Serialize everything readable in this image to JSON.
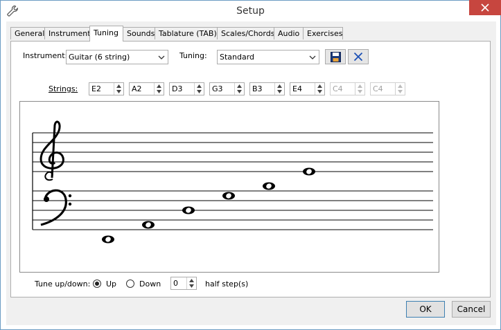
{
  "window": {
    "title": "Setup",
    "icon": "wrench-icon"
  },
  "tabs": [
    {
      "label": "General"
    },
    {
      "label": "Instruments"
    },
    {
      "label": "Tuning"
    },
    {
      "label": "Sounds"
    },
    {
      "label": "Tablature (TAB)"
    },
    {
      "label": "Scales/Chords"
    },
    {
      "label": "Audio"
    },
    {
      "label": "Exercises"
    }
  ],
  "active_tab": "Tuning",
  "instrument": {
    "label": "Instrument:",
    "value": "Guitar (6 string)"
  },
  "tuning": {
    "label": "Tuning:",
    "value": "Standard"
  },
  "strings": {
    "label": "Strings:",
    "items": [
      {
        "value": "E2",
        "enabled": true
      },
      {
        "value": "A2",
        "enabled": true
      },
      {
        "value": "D3",
        "enabled": true
      },
      {
        "value": "G3",
        "enabled": true
      },
      {
        "value": "B3",
        "enabled": true
      },
      {
        "value": "E4",
        "enabled": true
      },
      {
        "value": "C4",
        "enabled": false
      },
      {
        "value": "C4",
        "enabled": false
      }
    ]
  },
  "tune": {
    "label": "Tune up/down:",
    "up_label": "Up",
    "down_label": "Down",
    "selected": "Up",
    "steps_value": "0",
    "steps_suffix": "half step(s)"
  },
  "footer": {
    "ok_label": "OK",
    "cancel_label": "Cancel"
  },
  "colors": {
    "close_button": "#c7463f",
    "accent_blue": "#1a4fb4",
    "window_border": "#6b9bc3"
  }
}
